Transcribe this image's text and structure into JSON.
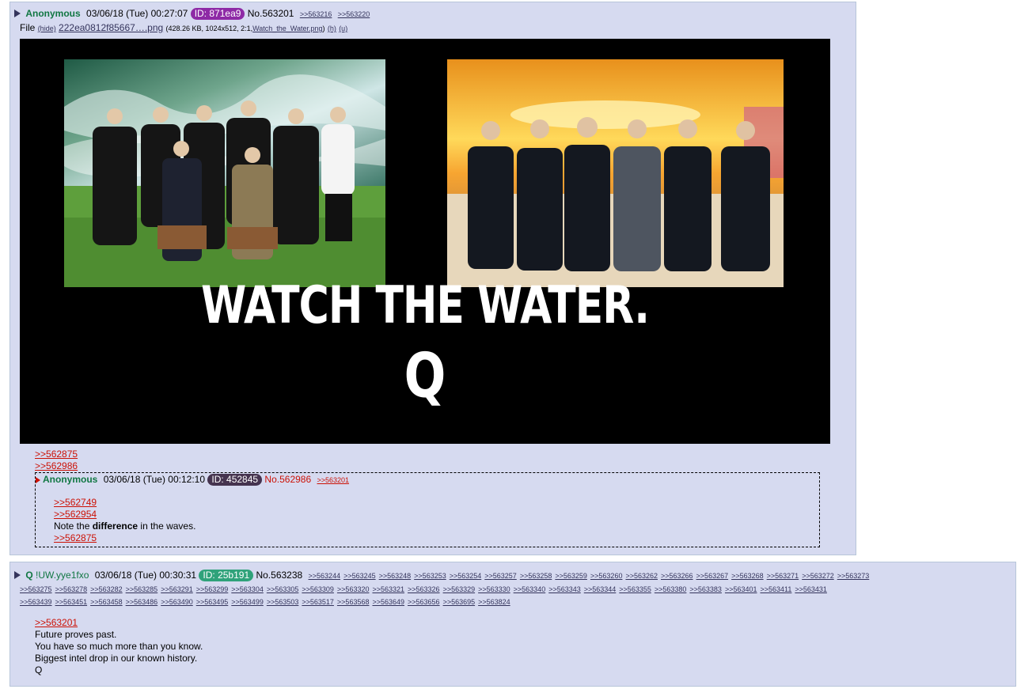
{
  "colors": {
    "name": "#117743",
    "link": "#34345c",
    "quote": "#cc1105",
    "post_bg": "#d6daf0",
    "id_purple": "#8e2aa6",
    "id_dark": "#45334f",
    "id_green": "#2fa27a"
  },
  "post1": {
    "name": "Anonymous",
    "datetime": "03/06/18 (Tue) 00:27:07",
    "id": "ID: 871ea9",
    "number": "No.563201",
    "backlinks": [
      ">>563216",
      ">>563220"
    ],
    "file": {
      "prefix": "File",
      "hide": "(hide)",
      "filename": "222ea0812f85667….png",
      "meta_before": "(428.26 KB, 1024x512, 2:1,",
      "original_name": "Watch_the_Water.png",
      "meta_after": ")",
      "h": "(h)",
      "u": "(u)"
    },
    "image": {
      "caption_line1": "WATCH THE WATER.",
      "caption_line2": "Q"
    },
    "quotes": [
      ">>562875",
      ">>562986"
    ],
    "inline_reply": {
      "name": "Anonymous",
      "datetime": "03/06/18 (Tue) 00:12:10",
      "id": "ID: 452845",
      "number": "No.562986",
      "backlink": ">>563201",
      "quotes": [
        ">>562749",
        ">>562954"
      ],
      "text_before": "Note the ",
      "text_bold": "difference",
      "text_after": " in the waves.",
      "quote_after": ">>562875"
    }
  },
  "post2": {
    "name": "Q",
    "tripcode": "!UW.yye1fxo",
    "datetime": "03/06/18 (Tue) 00:30:31",
    "id": "ID: 25b191",
    "number": "No.563238",
    "backlinks_row1": [
      ">>563244",
      ">>563245",
      ">>563248",
      ">>563253",
      ">>563254",
      ">>563257",
      ">>563258",
      ">>563259",
      ">>563260",
      ">>563262",
      ">>563266",
      ">>563267",
      ">>563268",
      ">>563271",
      ">>563272",
      ">>563273"
    ],
    "backlinks_row2": [
      ">>563275",
      ">>563278",
      ">>563282",
      ">>563285",
      ">>563291",
      ">>563299",
      ">>563304",
      ">>563305",
      ">>563309",
      ">>563320",
      ">>563321",
      ">>563326",
      ">>563329",
      ">>563330",
      ">>563340",
      ">>563343",
      ">>563344",
      ">>563355",
      ">>563380",
      ">>563383",
      ">>563401",
      ">>563411",
      ">>563431"
    ],
    "backlinks_row3": [
      ">>563439",
      ">>563451",
      ">>563458",
      ">>563486",
      ">>563490",
      ">>563495",
      ">>563499",
      ">>563503",
      ">>563517",
      ">>563568",
      ">>563649",
      ">>563656",
      ">>563695",
      ">>563824"
    ],
    "quote": ">>563201",
    "lines": [
      "Future proves past.",
      "You have so much more than you know.",
      "Biggest intel drop in our known history.",
      "Q"
    ]
  }
}
